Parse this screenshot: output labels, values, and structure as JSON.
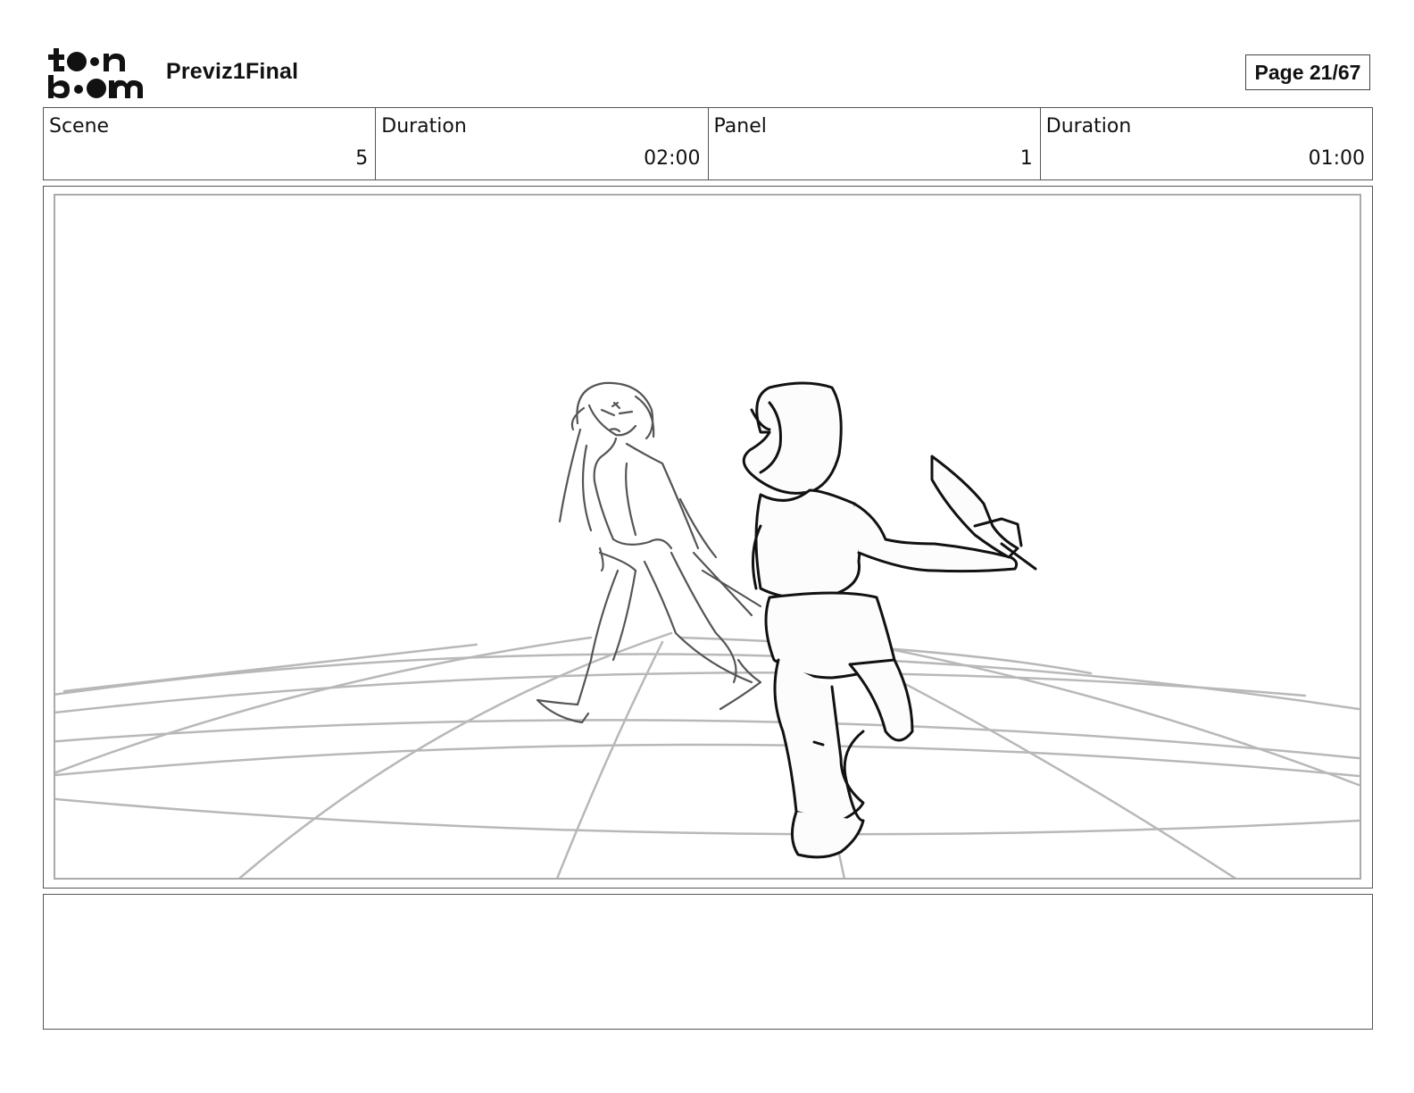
{
  "header": {
    "logo": {
      "icon": "toon-boom-logo",
      "wordmark": "toon boom"
    },
    "project_title": "Previz1Final",
    "page_indicator": "Page 21/67"
  },
  "info_bar": {
    "cells": [
      {
        "label": "Scene",
        "value": "5"
      },
      {
        "label": "Duration",
        "value": "02:00"
      },
      {
        "label": "Panel",
        "value": "1"
      },
      {
        "label": "Duration",
        "value": "01:00"
      }
    ]
  },
  "panel": {
    "image_icon": "storyboard-sketch-two-fighters-icon"
  },
  "notes": {
    "text": ""
  },
  "colors": {
    "frame_border": "#555555",
    "inner_border": "#aaaaaa",
    "grid_lines": "#b8b8b8",
    "sketch_dark": "#111111",
    "sketch_mid": "#555555"
  }
}
